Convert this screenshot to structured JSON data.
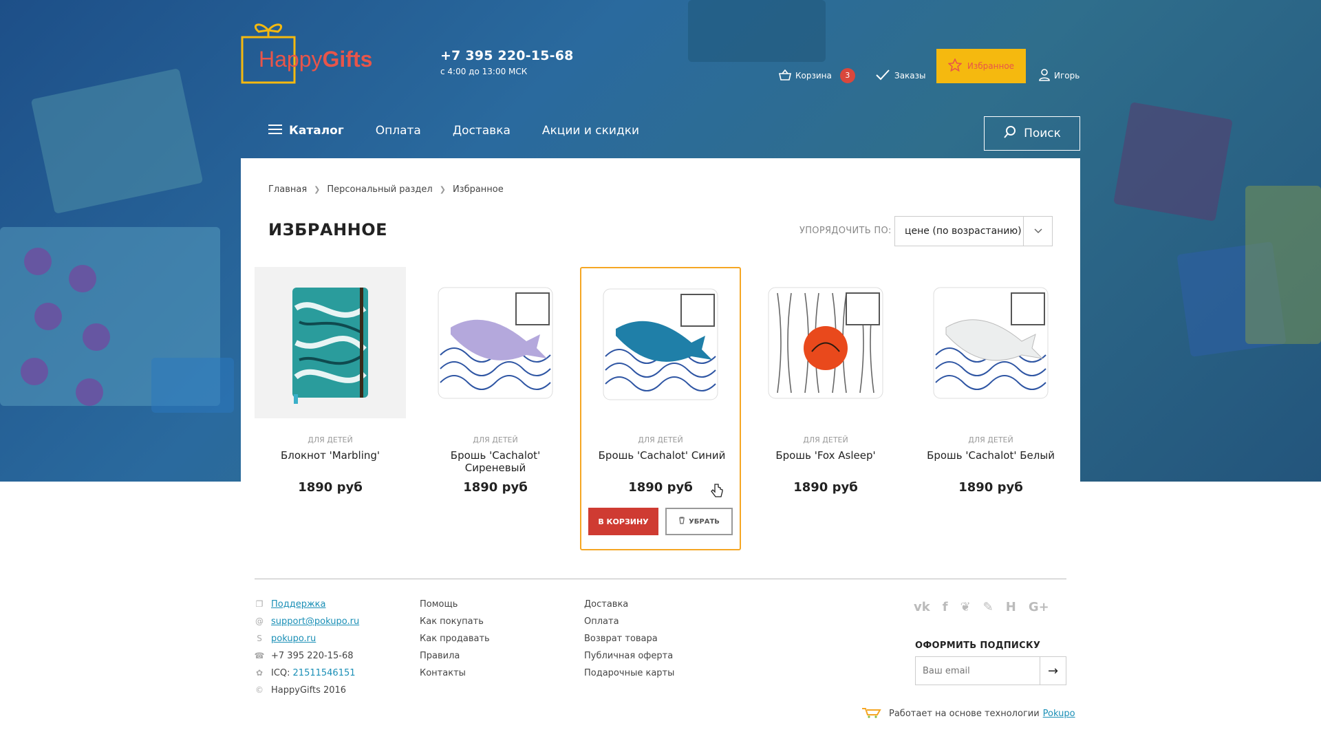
{
  "header": {
    "logo_text_a": "Happy",
    "logo_text_b": "Gifts",
    "phone": "+7 395 220-15-68",
    "hours": "с 4:00 до 13:00 МСК",
    "cart_label": "Корзина",
    "cart_count": "3",
    "orders_label": "Заказы",
    "favorites_label": "Избранное",
    "user_label": "Игорь"
  },
  "nav": {
    "catalog": "Каталог",
    "items": [
      "Оплата",
      "Доставка",
      "Акции и скидки"
    ],
    "search": "Поиск"
  },
  "breadcrumb": [
    "Главная",
    "Персональный раздел",
    "Избранное"
  ],
  "page_title": "ИЗБРАННОЕ",
  "sort": {
    "label": "УПОРЯДОЧИТЬ ПО:",
    "value": "цене (по возрастанию)"
  },
  "products": [
    {
      "category": "ДЛЯ ДЕТЕЙ",
      "name": "Блокнот 'Marbling'",
      "price": "1890 руб"
    },
    {
      "category": "ДЛЯ ДЕТЕЙ",
      "name": "Брошь 'Cachalot' Сиреневый",
      "price": "1890 руб"
    },
    {
      "category": "ДЛЯ ДЕТЕЙ",
      "name": "Брошь 'Cachalot' Синий",
      "price": "1890 руб"
    },
    {
      "category": "ДЛЯ ДЕТЕЙ",
      "name": "Брошь 'Fox Asleep'",
      "price": "1890 руб"
    },
    {
      "category": "ДЛЯ ДЕТЕЙ",
      "name": "Брошь 'Cachalot' Белый",
      "price": "1890 руб"
    }
  ],
  "card_actions": {
    "add_to_cart": "В КОРЗИНУ",
    "remove": "УБРАТЬ"
  },
  "footer": {
    "contacts": {
      "support": "Поддержка",
      "email": "support@pokupo.ru",
      "skype": "pokupo.ru",
      "phone": "+7 395 220-15-68",
      "icq_label": "ICQ:",
      "icq": "21511546151",
      "copyright": "HappyGifts 2016"
    },
    "col2": [
      "Помощь",
      "Как покупать",
      "Как продавать",
      "Правила",
      "Контакты"
    ],
    "col3": [
      "Доставка",
      "Оплата",
      "Возврат товара",
      "Публичная оферта",
      "Подарочные карты"
    ],
    "socials": [
      "vk",
      "f",
      "twitter",
      "feather",
      "H",
      "G+"
    ],
    "subscribe_title": "ОФОРМИТЬ ПОДПИСКУ",
    "email_placeholder": "Ваш email",
    "powered_text": "Работает на основе технологии",
    "powered_link": "Pokupo"
  },
  "colors": {
    "accent": "#f5b90f",
    "cart_button": "#cf3b32",
    "link": "#1a8fb6",
    "selected_border": "#f5a623"
  }
}
